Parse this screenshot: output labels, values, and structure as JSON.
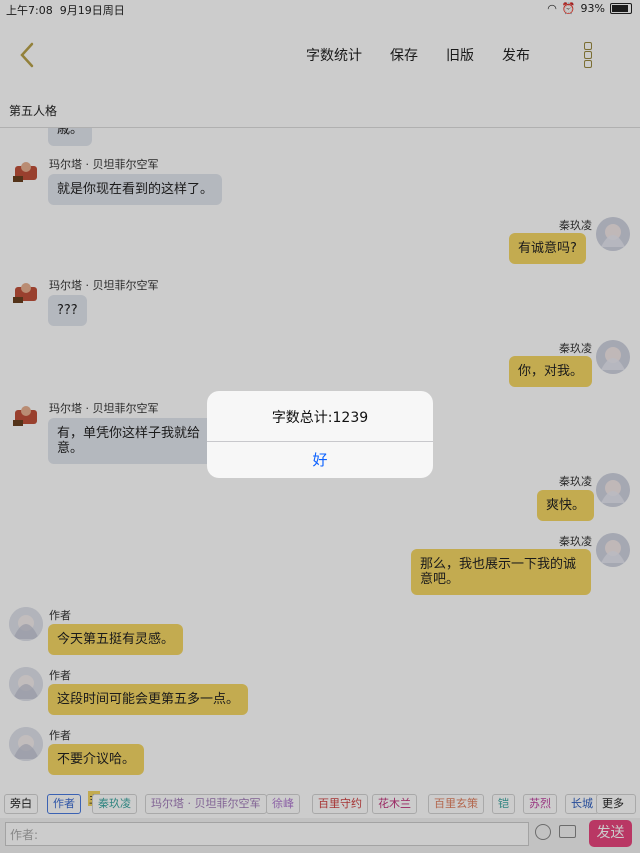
{
  "status": {
    "time": "上午7:08",
    "date": "9月19日周日",
    "battery": "93%"
  },
  "nav": {
    "word_count": "字数统计",
    "save": "保存",
    "old_version": "旧版",
    "publish": "发布"
  },
  "subtitle": "第五人格",
  "messages": [
    {
      "side": "left",
      "speaker": "",
      "text": "戚。",
      "avatar": "boy"
    },
    {
      "side": "left",
      "speaker": "玛尔塔 · 贝坦菲尔空军",
      "text": "就是你现在看到的这样了。",
      "avatar": "boy"
    },
    {
      "side": "right",
      "speaker": "秦玖凌",
      "text": "有诚意吗?",
      "avatar": "girl"
    },
    {
      "side": "left",
      "speaker": "玛尔塔 · 贝坦菲尔空军",
      "text": "???",
      "avatar": "boy"
    },
    {
      "side": "right",
      "speaker": "秦玖凌",
      "text": "你，对我。",
      "avatar": "girl"
    },
    {
      "side": "left",
      "speaker": "玛尔塔 · 贝坦菲尔空军",
      "text": "有，单凭你这样子我就给",
      "text2": "意。",
      "avatar": "boy"
    },
    {
      "side": "right",
      "speaker": "秦玖凌",
      "text": "爽快。",
      "avatar": "girl"
    },
    {
      "side": "right",
      "speaker": "秦玖凌",
      "text": "那么，我也展示一下我的诚",
      "text2": "意吧。",
      "avatar": "girl"
    },
    {
      "side": "left",
      "speaker": "作者",
      "text": "今天第五挺有灵感。",
      "avatar": "author"
    },
    {
      "side": "left",
      "speaker": "作者",
      "text": "这段时间可能会更第五多一点。",
      "avatar": "author"
    },
    {
      "side": "left",
      "speaker": "作者",
      "text": "不要介议哈。",
      "avatar": "author"
    }
  ],
  "alert": {
    "title": "字数总计:1239",
    "ok": "好"
  },
  "roles": {
    "narration": "旁白",
    "author": "作者",
    "main_badge": "主",
    "items": [
      {
        "label": "秦玖凌",
        "color": "#3aa6a0"
      },
      {
        "label": "玛尔塔 · 贝坦菲尔空军",
        "color": "#a07ab8"
      },
      {
        "label": "徐峰",
        "color": "#b07ad0"
      },
      {
        "label": "百里守约",
        "color": "#d04040"
      },
      {
        "label": "花木兰",
        "color": "#c0307a"
      },
      {
        "label": "百里玄策",
        "color": "#e08060"
      },
      {
        "label": "铠",
        "color": "#3aa6a0"
      },
      {
        "label": "苏烈",
        "color": "#c040a0"
      },
      {
        "label": "长城",
        "color": "#3060c0"
      }
    ],
    "more": "更多"
  },
  "input": {
    "placeholder": "作者:",
    "send": "发送"
  },
  "colors": {
    "grey_bubble": "#e2e6ee",
    "yellow_bubble": "#f4d665",
    "send": "#e8457d",
    "link": "#0a60ff"
  }
}
